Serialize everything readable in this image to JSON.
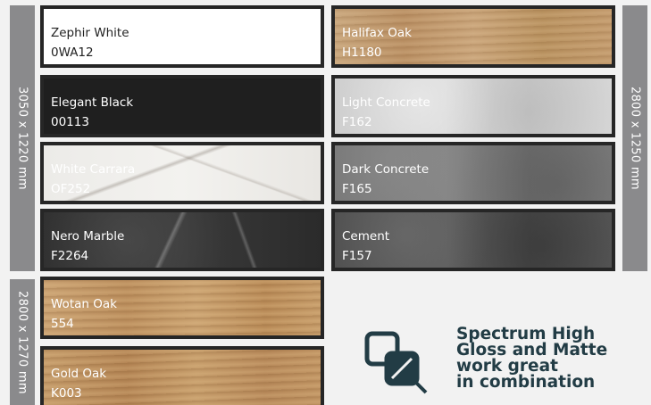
{
  "size_labels": {
    "left_top": "3050 x 1220 mm",
    "left_bottom": "2800 x 1270 mm",
    "right": "2800 x 1250 mm"
  },
  "swatches": [
    {
      "name": "Zephir White",
      "code": "0WA12"
    },
    {
      "name": "Halifax Oak",
      "code": "H1180"
    },
    {
      "name": "Elegant Black",
      "code": "00113"
    },
    {
      "name": "Light Concrete",
      "code": "F162"
    },
    {
      "name": "White Carrara",
      "code": "OF252"
    },
    {
      "name": "Dark Concrete",
      "code": "F165"
    },
    {
      "name": "Nero Marble",
      "code": "F2264"
    },
    {
      "name": "Cement",
      "code": "F157"
    },
    {
      "name": "Wotan Oak",
      "code": "554"
    },
    {
      "name": "Gold Oak",
      "code": "K003"
    }
  ],
  "combination": {
    "lines": [
      "Spectrum High",
      "Gloss and Matte",
      "work great",
      "in combination"
    ],
    "icon": "overlapping-squares-icon"
  },
  "colors": {
    "side_bar": "#8a8a8c",
    "swatch_border": "#262626",
    "combo_text": "#223c45"
  }
}
